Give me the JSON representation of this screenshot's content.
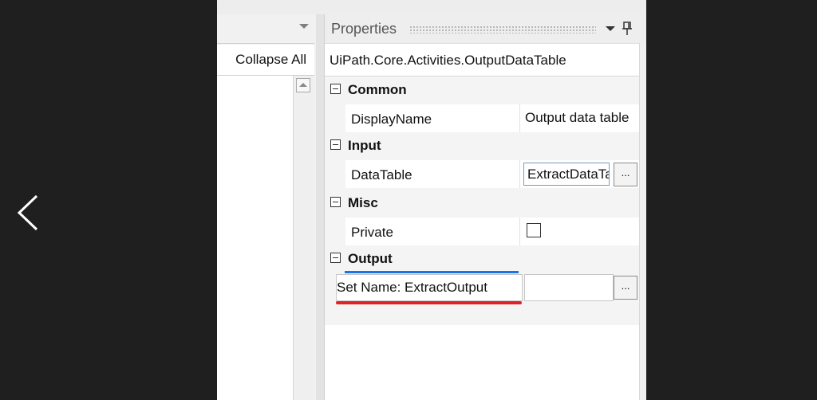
{
  "left_panel": {
    "collapse_all_label": "Collapse All"
  },
  "properties": {
    "title": "Properties",
    "activity_type": "UiPath.Core.Activities.OutputDataTable",
    "categories": {
      "common": {
        "label": "Common",
        "display_name": {
          "name": "DisplayName",
          "value": "Output data table"
        }
      },
      "input": {
        "label": "Input",
        "data_table": {
          "name": "DataTable",
          "value": "ExtractDataTable"
        }
      },
      "misc": {
        "label": "Misc",
        "private": {
          "name": "Private",
          "checked": false
        }
      },
      "output": {
        "label": "Output",
        "set_name_text": "Set Name:  ExtractOutput"
      }
    },
    "ellipsis_label": "..."
  },
  "colors": {
    "highlight_underline": "#e0212a",
    "focus_line": "#1a73e8"
  }
}
